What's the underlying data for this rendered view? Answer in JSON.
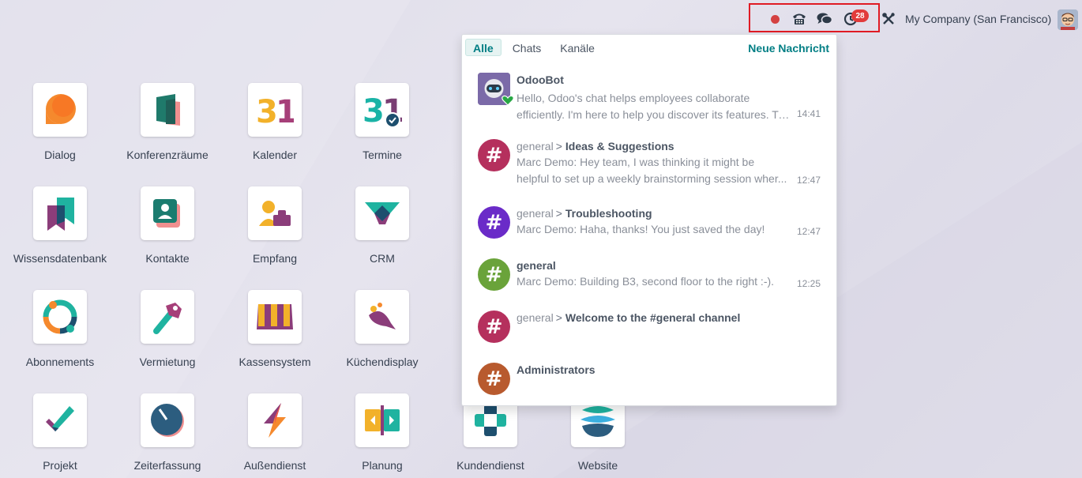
{
  "systray": {
    "badge_count": "28",
    "company": "My Company (San Francisco)"
  },
  "apps": [
    {
      "label": "Dialog",
      "icon": "dialog-icon"
    },
    {
      "label": "Konferenzräume",
      "icon": "meeting-rooms-icon"
    },
    {
      "label": "Kalender",
      "icon": "calendar-icon"
    },
    {
      "label": "Termine",
      "icon": "appointments-icon"
    },
    {
      "label": "Wissensdatenbank",
      "icon": "knowledge-icon"
    },
    {
      "label": "Kontakte",
      "icon": "contacts-icon"
    },
    {
      "label": "Empfang",
      "icon": "frontdesk-icon"
    },
    {
      "label": "CRM",
      "icon": "crm-icon"
    },
    {
      "label": "Abonnements",
      "icon": "subscriptions-icon"
    },
    {
      "label": "Vermietung",
      "icon": "rental-icon"
    },
    {
      "label": "Kassensystem",
      "icon": "pos-icon"
    },
    {
      "label": "Küchendisplay",
      "icon": "kitchen-display-icon"
    },
    {
      "label": "Projekt",
      "icon": "project-icon"
    },
    {
      "label": "Zeiterfassung",
      "icon": "timesheet-icon"
    },
    {
      "label": "Außendienst",
      "icon": "field-service-icon"
    },
    {
      "label": "Planung",
      "icon": "planning-icon"
    },
    {
      "label": "Kundendienst",
      "icon": "helpdesk-icon"
    },
    {
      "label": "Website",
      "icon": "website-icon"
    }
  ],
  "messaging": {
    "tabs": [
      {
        "label": "Alle",
        "active": true
      },
      {
        "label": "Chats",
        "active": false
      },
      {
        "label": "Kanäle",
        "active": false
      }
    ],
    "new_message": "Neue Nachricht",
    "items": [
      {
        "title": "OdooBot",
        "line1": "Hello, Odoo's chat helps employees collaborate",
        "line2": "efficiently. I'm here to help you discover its features. Tr...",
        "time": "14:41",
        "icon_color": "#6b5f95"
      },
      {
        "prefix": "general",
        "title": "Ideas & Suggestions",
        "line1": "Marc Demo: Hey team, I was thinking it might be",
        "line2": "helpful to set up a weekly brainstorming session wher...",
        "time": "12:47",
        "icon_color": "#b5305d"
      },
      {
        "prefix": "general",
        "title": "Troubleshooting",
        "line1": "Marc Demo: Haha, thanks! You just saved the day!",
        "time": "12:47",
        "icon_color": "#6a2bc8"
      },
      {
        "title": "general",
        "line1": "Marc Demo: Building B3, second floor to the right :-).",
        "time": "12:25",
        "icon_color": "#6aa33a"
      },
      {
        "prefix": "general",
        "title": "Welcome to the #general channel",
        "icon_color": "#b5305d"
      },
      {
        "title": "Administrators",
        "icon_color": "#b85a2e"
      }
    ]
  }
}
